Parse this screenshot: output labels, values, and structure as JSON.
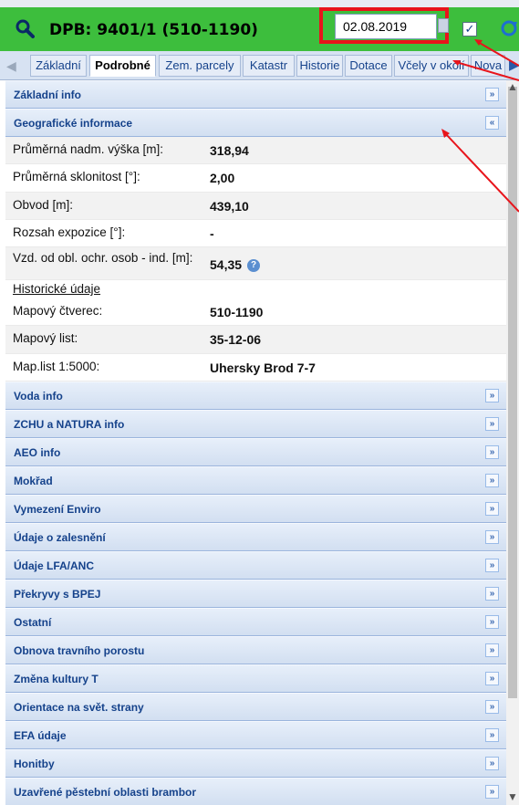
{
  "header": {
    "title": "DPB: 9401/1 (510-1190)",
    "date_value": "02.08.2019",
    "checkbox_mark": "✓"
  },
  "tabs": [
    {
      "label": "Základní"
    },
    {
      "label": "Podrobné",
      "active": true
    },
    {
      "label": "Zem. parcely"
    },
    {
      "label": "Katastr"
    },
    {
      "label": "Historie"
    },
    {
      "label": "Dotace"
    },
    {
      "label": "Včely v okolí"
    },
    {
      "label": "Nova"
    }
  ],
  "panels_top": [
    {
      "title": "Základní info",
      "collapsed": true
    },
    {
      "title": "Geografické informace",
      "collapsed": false
    }
  ],
  "geo_rows": [
    {
      "label": "Průměrná nadm. výška [m]:",
      "value": "318,94"
    },
    {
      "label": "Průměrná sklonitost [°]:",
      "value": "2,00"
    },
    {
      "label": "Obvod [m]:",
      "value": "439,10"
    },
    {
      "label": "Rozsah expozice [°]:",
      "value": "-"
    },
    {
      "label": "Vzd. od obl. ochr. osob - ind. [m]:",
      "value": "54,35"
    }
  ],
  "historic_link": "Historické údaje",
  "map_rows": [
    {
      "label": "Mapový čtverec:",
      "value": "510-1190"
    },
    {
      "label": "Mapový list:",
      "value": "35-12-06"
    },
    {
      "label": "Map.list 1:5000:",
      "value": "Uhersky Brod 7-7"
    }
  ],
  "panels_bottom": [
    {
      "title": "Voda info"
    },
    {
      "title": "ZCHU a NATURA info"
    },
    {
      "title": "AEO info"
    },
    {
      "title": "Mokřad"
    },
    {
      "title": "Vymezení Enviro"
    },
    {
      "title": "Údaje o zalesnění"
    },
    {
      "title": "Údaje LFA/ANC"
    },
    {
      "title": "Překryvy s BPEJ"
    },
    {
      "title": "Ostatní"
    },
    {
      "title": "Obnova travního porostu"
    },
    {
      "title": "Změna kultury T"
    },
    {
      "title": "Orientace na svět. strany"
    },
    {
      "title": "EFA údaje"
    },
    {
      "title": "Honitby"
    },
    {
      "title": "Uzavřené pěstební oblasti brambor"
    }
  ],
  "icons": {
    "expand": "»",
    "collapse": "«",
    "help": "?",
    "tab_left": "◀",
    "tab_right": "▶",
    "scroll_up": "▲",
    "scroll_down": "▼"
  },
  "colors": {
    "header_bg": "#3dbe3d",
    "highlight": "#e8141b",
    "panel_title": "#15428b"
  }
}
